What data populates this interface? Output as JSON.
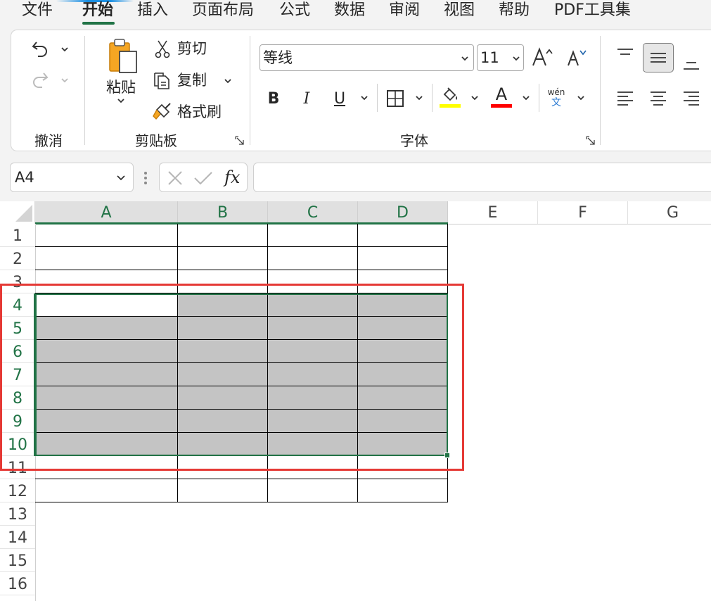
{
  "menu": {
    "tabs": [
      "文件",
      "开始",
      "插入",
      "页面布局",
      "公式",
      "数据",
      "审阅",
      "视图",
      "帮助",
      "PDF工具集"
    ],
    "active_tab": "开始"
  },
  "ribbon": {
    "undo_group": {
      "label": "撤消"
    },
    "clipboard": {
      "label": "剪贴板",
      "paste": "粘贴",
      "cut": "剪切",
      "copy": "复制",
      "format_painter": "格式刷"
    },
    "font": {
      "label": "字体",
      "font_name": "等线",
      "font_size": "11",
      "bold": "B",
      "italic": "I",
      "underline": "U",
      "font_color_glyph": "A",
      "phonetic_top": "wén",
      "phonetic_bottom": "文",
      "highlight_color": "#ffff00",
      "font_color": "#ff0000"
    }
  },
  "formula_bar": {
    "name_box": "A4",
    "fx_label": "fx",
    "formula": ""
  },
  "sheet": {
    "columns": [
      "A",
      "B",
      "C",
      "D",
      "E",
      "F",
      "G"
    ],
    "selected_columns": [
      "A",
      "B",
      "C",
      "D"
    ],
    "rows": [
      "1",
      "2",
      "3",
      "4",
      "5",
      "6",
      "7",
      "8",
      "9",
      "10",
      "11",
      "12",
      "13",
      "14",
      "15",
      "16"
    ],
    "selected_rows": [
      "4",
      "5",
      "6",
      "7",
      "8",
      "9",
      "10"
    ],
    "active_cell": "A4",
    "selection": "A4:D10",
    "bordered_range": "A1:D12",
    "accent_color": "#217346",
    "highlight_box_color": "#e53935"
  }
}
